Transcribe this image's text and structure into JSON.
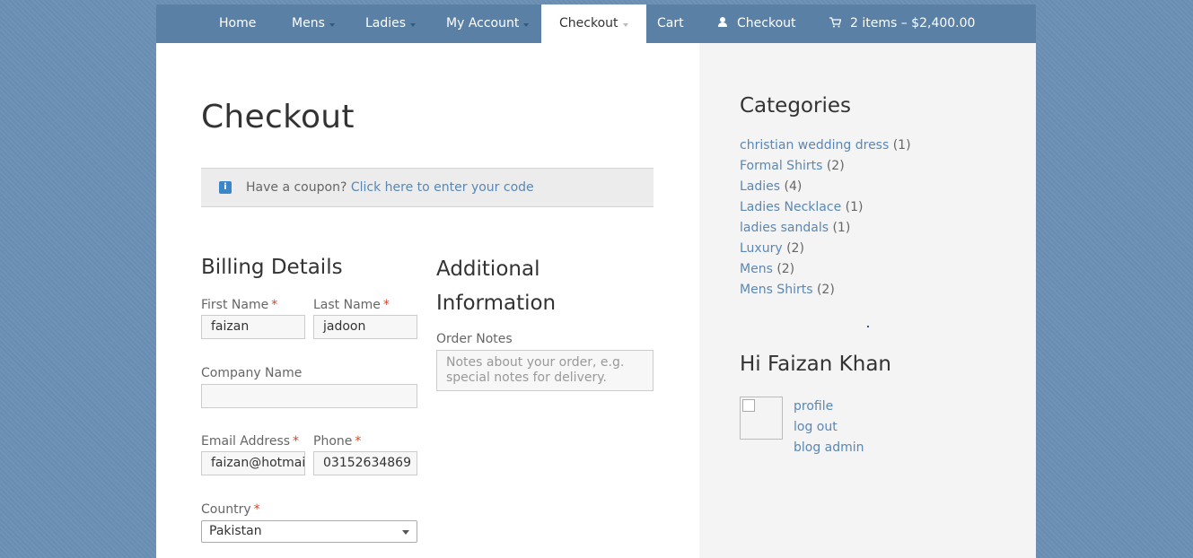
{
  "nav": {
    "items": [
      {
        "label": "Home",
        "has_dropdown": false
      },
      {
        "label": "Mens",
        "has_dropdown": true
      },
      {
        "label": "Ladies",
        "has_dropdown": true
      },
      {
        "label": "My Account",
        "has_dropdown": true
      },
      {
        "label": "Checkout",
        "has_dropdown": true,
        "active": true
      },
      {
        "label": "Cart",
        "has_dropdown": false
      },
      {
        "label": "Checkout",
        "icon": "user-icon"
      },
      {
        "label": "2 items – $2,400.00",
        "icon": "cart-icon"
      }
    ]
  },
  "page": {
    "title": "Checkout"
  },
  "coupon": {
    "icon": "info-icon",
    "prompt": "Have a coupon?",
    "link": "Click here to enter your code"
  },
  "billing": {
    "title": "Billing Details",
    "first_name": {
      "label": "First Name",
      "required": "*",
      "value": "faizan"
    },
    "last_name": {
      "label": "Last Name",
      "required": "*",
      "value": "jadoon"
    },
    "company": {
      "label": "Company Name",
      "value": ""
    },
    "email": {
      "label": "Email Address",
      "required": "*",
      "value": "faizan@hotmail.com"
    },
    "phone": {
      "label": "Phone",
      "required": "*",
      "value": "03152634869"
    },
    "country": {
      "label": "Country",
      "required": "*",
      "value": "Pakistan"
    }
  },
  "additional": {
    "title": "Additional Information",
    "order_notes": {
      "label": "Order Notes",
      "placeholder": "Notes about your order, e.g. special notes for delivery."
    }
  },
  "sidebar": {
    "categories_title": "Categories",
    "categories": [
      {
        "name": "christian wedding dress",
        "count": "(1)"
      },
      {
        "name": "Formal Shirts",
        "count": "(2)"
      },
      {
        "name": "Ladies",
        "count": "(4)"
      },
      {
        "name": "Ladies Necklace",
        "count": "(1)"
      },
      {
        "name": "ladies sandals",
        "count": "(1)"
      },
      {
        "name": "Luxury",
        "count": "(2)"
      },
      {
        "name": "Mens",
        "count": "(2)"
      },
      {
        "name": "Mens Shirts",
        "count": "(2)"
      }
    ],
    "greeting": "Hi Faizan Khan",
    "user_links": [
      "profile",
      "log out",
      "blog admin"
    ]
  },
  "colors": {
    "nav_bg": "#5a80a6",
    "link": "#5a87b3",
    "required": "#e2401c",
    "page_bg": "#6b8fb5"
  }
}
